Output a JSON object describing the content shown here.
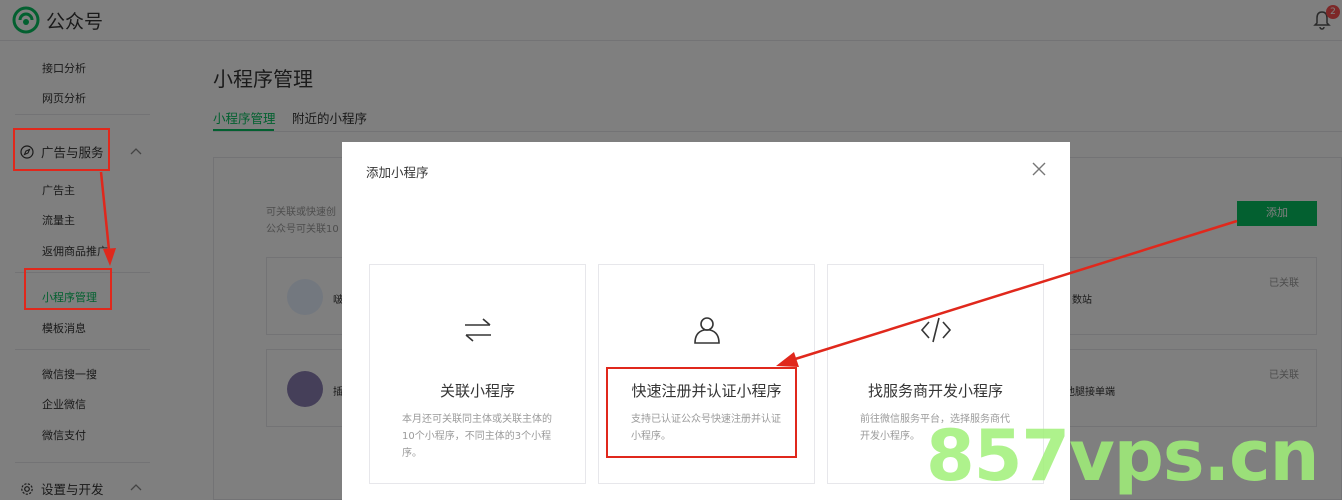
{
  "brand": {
    "name": "公众号"
  },
  "notifications": {
    "count": "2",
    "icon": "bell-icon"
  },
  "sidebar": {
    "items_top": [
      "接口分析",
      "网页分析"
    ],
    "group_ads": {
      "label": "广告与服务",
      "icon": "compass-icon"
    },
    "ads_items": [
      "广告主",
      "流量主",
      "返佣商品推广"
    ],
    "active_item": "小程序管理",
    "item_template": "模板消息",
    "items_other": [
      "微信搜一搜",
      "企业微信",
      "微信支付"
    ],
    "group_settings": {
      "label": "设置与开发",
      "icon": "gear-icon"
    }
  },
  "main": {
    "title": "小程序管理",
    "tabs": [
      "小程序管理",
      "附近的小程序"
    ],
    "desc_lines": [
      "可关联或快速创",
      "公众号可关联10"
    ],
    "add_button": "添加",
    "cards": [
      {
        "name": "啵",
        "right_text": "数站",
        "status": "已关联"
      },
      {
        "name": "插",
        "right_text": "池腿接单端",
        "status": "已关联"
      }
    ]
  },
  "modal": {
    "title": "添加小程序",
    "options": [
      {
        "title": "关联小程序",
        "desc": "本月还可关联同主体或关联主体的10个小程序，不同主体的3个小程序。",
        "icon": "swap-arrows-icon"
      },
      {
        "title": "快速注册并认证小程序",
        "desc": "支持已认证公众号快速注册并认证小程序。",
        "icon": "user-icon"
      },
      {
        "title": "找服务商开发小程序",
        "desc": "前往微信服务平台，选择服务商代开发小程序。",
        "icon": "code-icon"
      }
    ]
  },
  "watermark": "857vps.cn",
  "colors": {
    "brand_green": "#07c160",
    "highlight_red": "#e0281c"
  }
}
